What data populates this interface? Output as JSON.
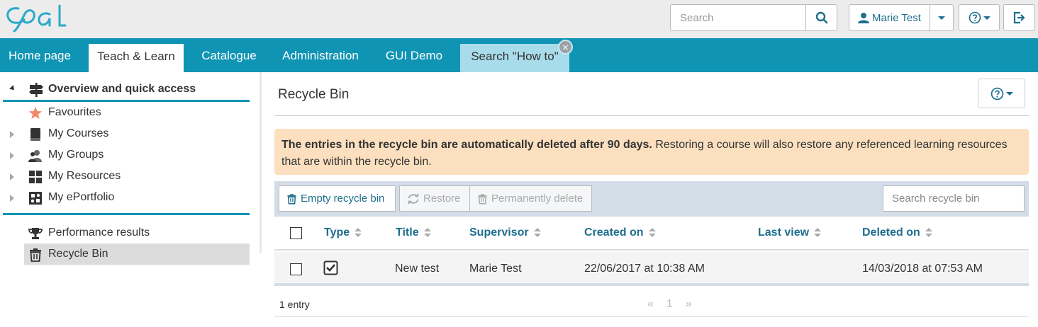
{
  "header": {
    "logo_text": "Opal",
    "search_placeholder": "Search",
    "user_name": "Marie Test"
  },
  "nav": {
    "tabs": [
      {
        "label": "Home page"
      },
      {
        "label": "Teach & Learn"
      },
      {
        "label": "Catalogue"
      },
      {
        "label": "Administration"
      },
      {
        "label": "GUI Demo"
      },
      {
        "label": "Search \"How to\""
      }
    ],
    "active_tab": "Teach & Learn"
  },
  "sidebar": {
    "header": "Overview and quick access",
    "items": [
      {
        "label": "Favourites",
        "icon": "star-icon"
      },
      {
        "label": "My Courses",
        "icon": "book-icon"
      },
      {
        "label": "My Groups",
        "icon": "group-icon"
      },
      {
        "label": "My Resources",
        "icon": "grid-icon"
      },
      {
        "label": "My ePortfolio",
        "icon": "puzzle-icon"
      }
    ],
    "bottom_items": [
      {
        "label": "Performance results",
        "icon": "trophy-icon"
      },
      {
        "label": "Recycle Bin",
        "icon": "trash-icon"
      }
    ]
  },
  "main": {
    "title": "Recycle Bin",
    "alert_bold": "The entries in the recycle bin are automatically deleted after 90 days.",
    "alert_text": " Restoring a course will also restore any referenced learning resources that are within the recycle bin.",
    "toolbar": {
      "empty_label": "Empty recycle bin",
      "restore_label": "Restore",
      "delete_label": "Permanently delete",
      "search_placeholder": "Search recycle bin"
    },
    "table": {
      "columns": [
        "Type",
        "Title",
        "Supervisor",
        "Created on",
        "Last view",
        "Deleted on"
      ],
      "rows": [
        {
          "title": "New test",
          "supervisor": "Marie Test",
          "created_on": "22/06/2017 at 10:38 AM",
          "last_view": "",
          "deleted_on": "14/03/2018 at 07:53 AM"
        }
      ],
      "count_text": "1 entry",
      "pager": {
        "prev": "«",
        "page": "1",
        "next": "»"
      }
    }
  },
  "colors": {
    "brand": "#0f94b4",
    "link": "#1e6e8e",
    "alert_bg": "#fbdfbf",
    "toolbar_bg": "#d2dde8"
  }
}
